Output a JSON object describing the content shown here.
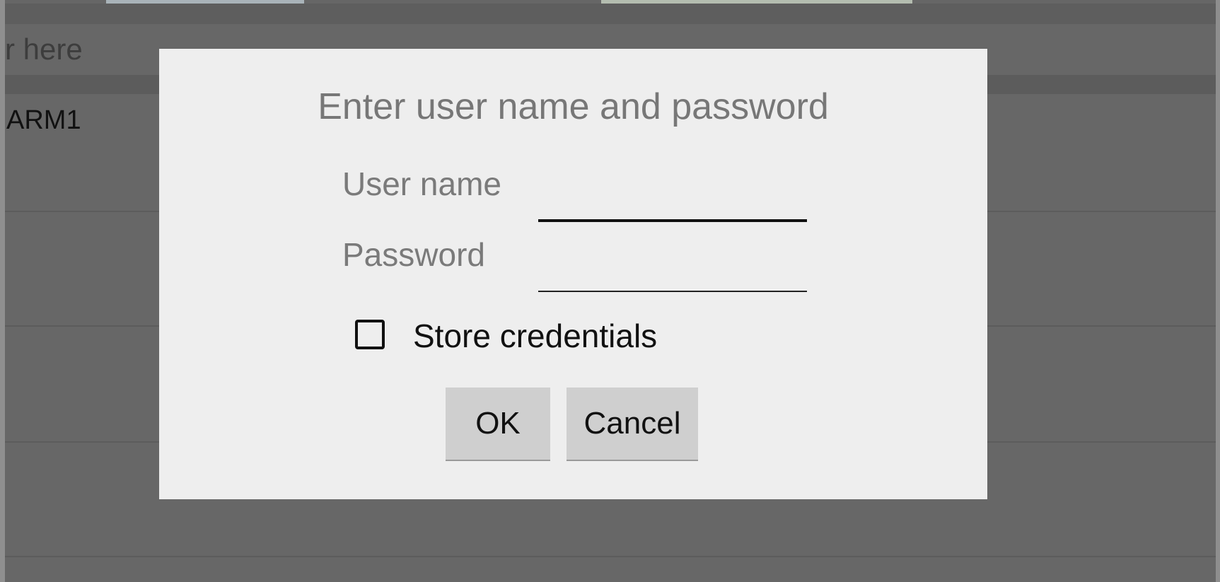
{
  "background_app": {
    "search_hint": "r here",
    "first_row_label": "ARM1"
  },
  "dialog": {
    "title": "Enter user name and password",
    "username_label": "User name",
    "username_value": "",
    "password_label": "Password",
    "password_value": "",
    "store_credentials_label": "Store credentials",
    "store_credentials_checked": false,
    "ok_label": "OK",
    "cancel_label": "Cancel"
  },
  "colors": {
    "dim_overlay": "#666666",
    "dialog_bg": "#eeeeee",
    "button_bg": "#cfcfcf",
    "label_gray": "#7a7a7a"
  }
}
